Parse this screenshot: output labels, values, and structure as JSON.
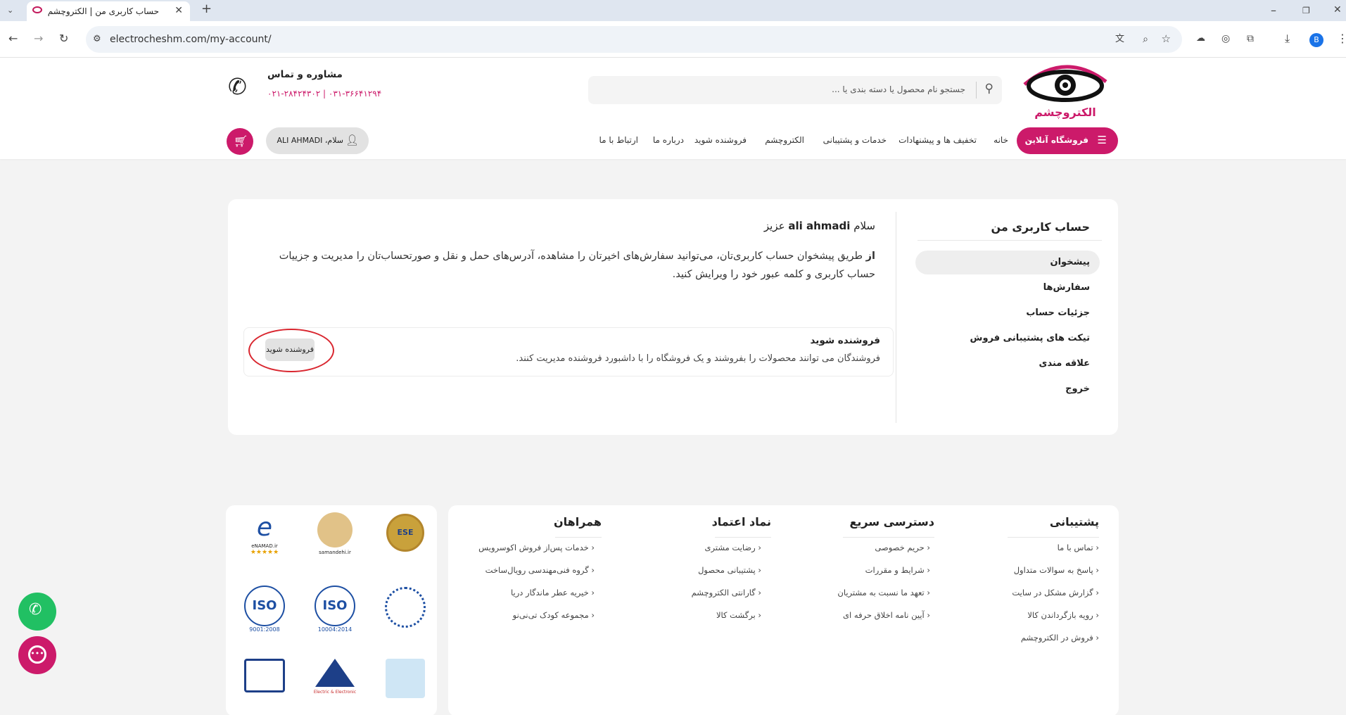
{
  "browser": {
    "tab_title": "حساب کاربری من | الکتروچشم",
    "url": "electrocheshm.com/my-account/",
    "profile_initial": "B"
  },
  "header": {
    "logo_text": "الکتروچشم",
    "search_placeholder": "جستجو نام محصول یا دسته بندی یا ...",
    "contact_title": "مشاوره و تماس",
    "contact_phones": "۰۳۱-۳۶۶۴۱۲۹۴ | ۰۲۱-۲۸۴۲۴۳۰۲",
    "shop_button": "فروشگاه آنلاین",
    "nav": [
      "خانه",
      "تخفیف ها و پیشنهادات",
      "خدمات و پشتیبانی",
      "الکتروچشم",
      "فروشنده شوید",
      "درباره ما",
      "ارتباط با ما"
    ],
    "user_greeting": "سلام، ALI AHMADI"
  },
  "account": {
    "sidebar_title": "حساب کاربری من",
    "menu": [
      "پیشخوان",
      "سفارش‌ها",
      "جزئیات حساب",
      "تیکت های پشتیبانی فروش",
      "علاقه مندی",
      "خروج"
    ],
    "greeting_prefix": "سلام",
    "greeting_name": "ali ahmadi",
    "greeting_suffix": "عزیز",
    "intro_bold": "از",
    "intro_text": " طریق پیشخوان حساب کاربری‌تان، می‌توانید سفارش‌های اخیرتان را مشاهده، آدرس‌های حمل و نقل و صورتحساب‌تان را مدیریت و جزییات حساب کاربری و کلمه عبور خود را ویرایش کنید.",
    "vendor_title": "فروشنده شوید",
    "vendor_desc": "فروشندگان می توانند محصولات را بفروشند و یک فروشگاه را با داشبورد فروشنده مدیریت کنند.",
    "vendor_button": "فروشنده شوید"
  },
  "footer": {
    "columns": [
      {
        "title": "پشتیبانی",
        "links": [
          "تماس با ما",
          "پاسخ به سوالات متداول",
          "گزارش مشکل در سایت",
          "رویه بازگرداندن کالا",
          "فروش در الکتروچشم"
        ]
      },
      {
        "title": "دسترسی سریع",
        "links": [
          "حریم خصوصی",
          "شرایط و مقررات",
          "تعهد ما نسبت به مشتریان",
          "آیین نامه اخلاق حرفه ای"
        ]
      },
      {
        "title": "نماد اعتماد",
        "links": [
          "رضایت مشتری",
          "پشتیبانی محصول",
          "گارانتی الکتروچشم",
          "برگشت کالا"
        ]
      },
      {
        "title": "همراهان",
        "links": [
          "خدمات پس‌از فروش اکوسرویس",
          "گروه فنی‌مهندسی رویال‌ساخت",
          "خیریه عطر ماندگار دریا",
          "مجموعه کودک تی‌نی‌نو"
        ]
      }
    ],
    "badges": {
      "enamad": "eNAMAD.ir",
      "samandehi": "samandehi.ir",
      "ese": "ESE",
      "iso1": "ISO",
      "iso1_code": "9001:2008",
      "iso2": "ISO",
      "iso2_code": "10004:2014",
      "electric": "Electric & Electronic"
    }
  },
  "colors": {
    "brand": "#cc1a6a",
    "whatsapp": "#21c063"
  }
}
